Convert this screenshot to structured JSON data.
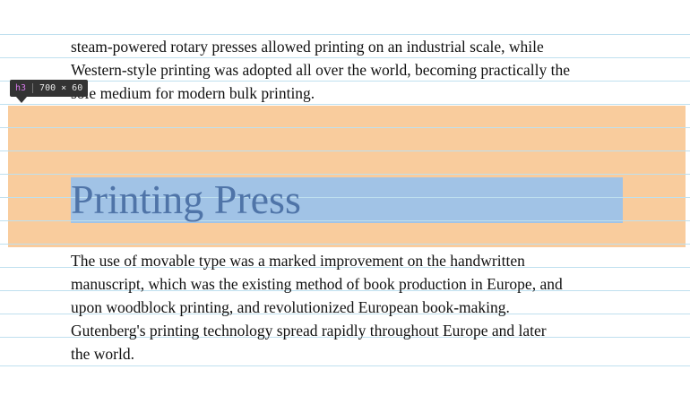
{
  "article": {
    "para_top_lines": [
      "steam-powered rotary presses allowed printing on an industrial scale, while",
      "Western-style printing was adopted all over the world, becoming practically the",
      "sole medium for modern bulk printing."
    ],
    "heading": "Printing Press",
    "para_bottom_lines": [
      "The use of movable type was a marked improvement on the handwritten",
      "manuscript, which was the existing method of book production in Europe, and",
      "upon woodblock printing, and revolutionized European book-making.",
      "Gutenberg's printing technology spread rapidly throughout Europe and later",
      "the world."
    ]
  },
  "inspector": {
    "tag": "h3",
    "dimensions": "700 × 60",
    "margin_color": "#f9cc9d",
    "content_color": "#a1c3e6",
    "grid_color": "#bfe0ef"
  }
}
